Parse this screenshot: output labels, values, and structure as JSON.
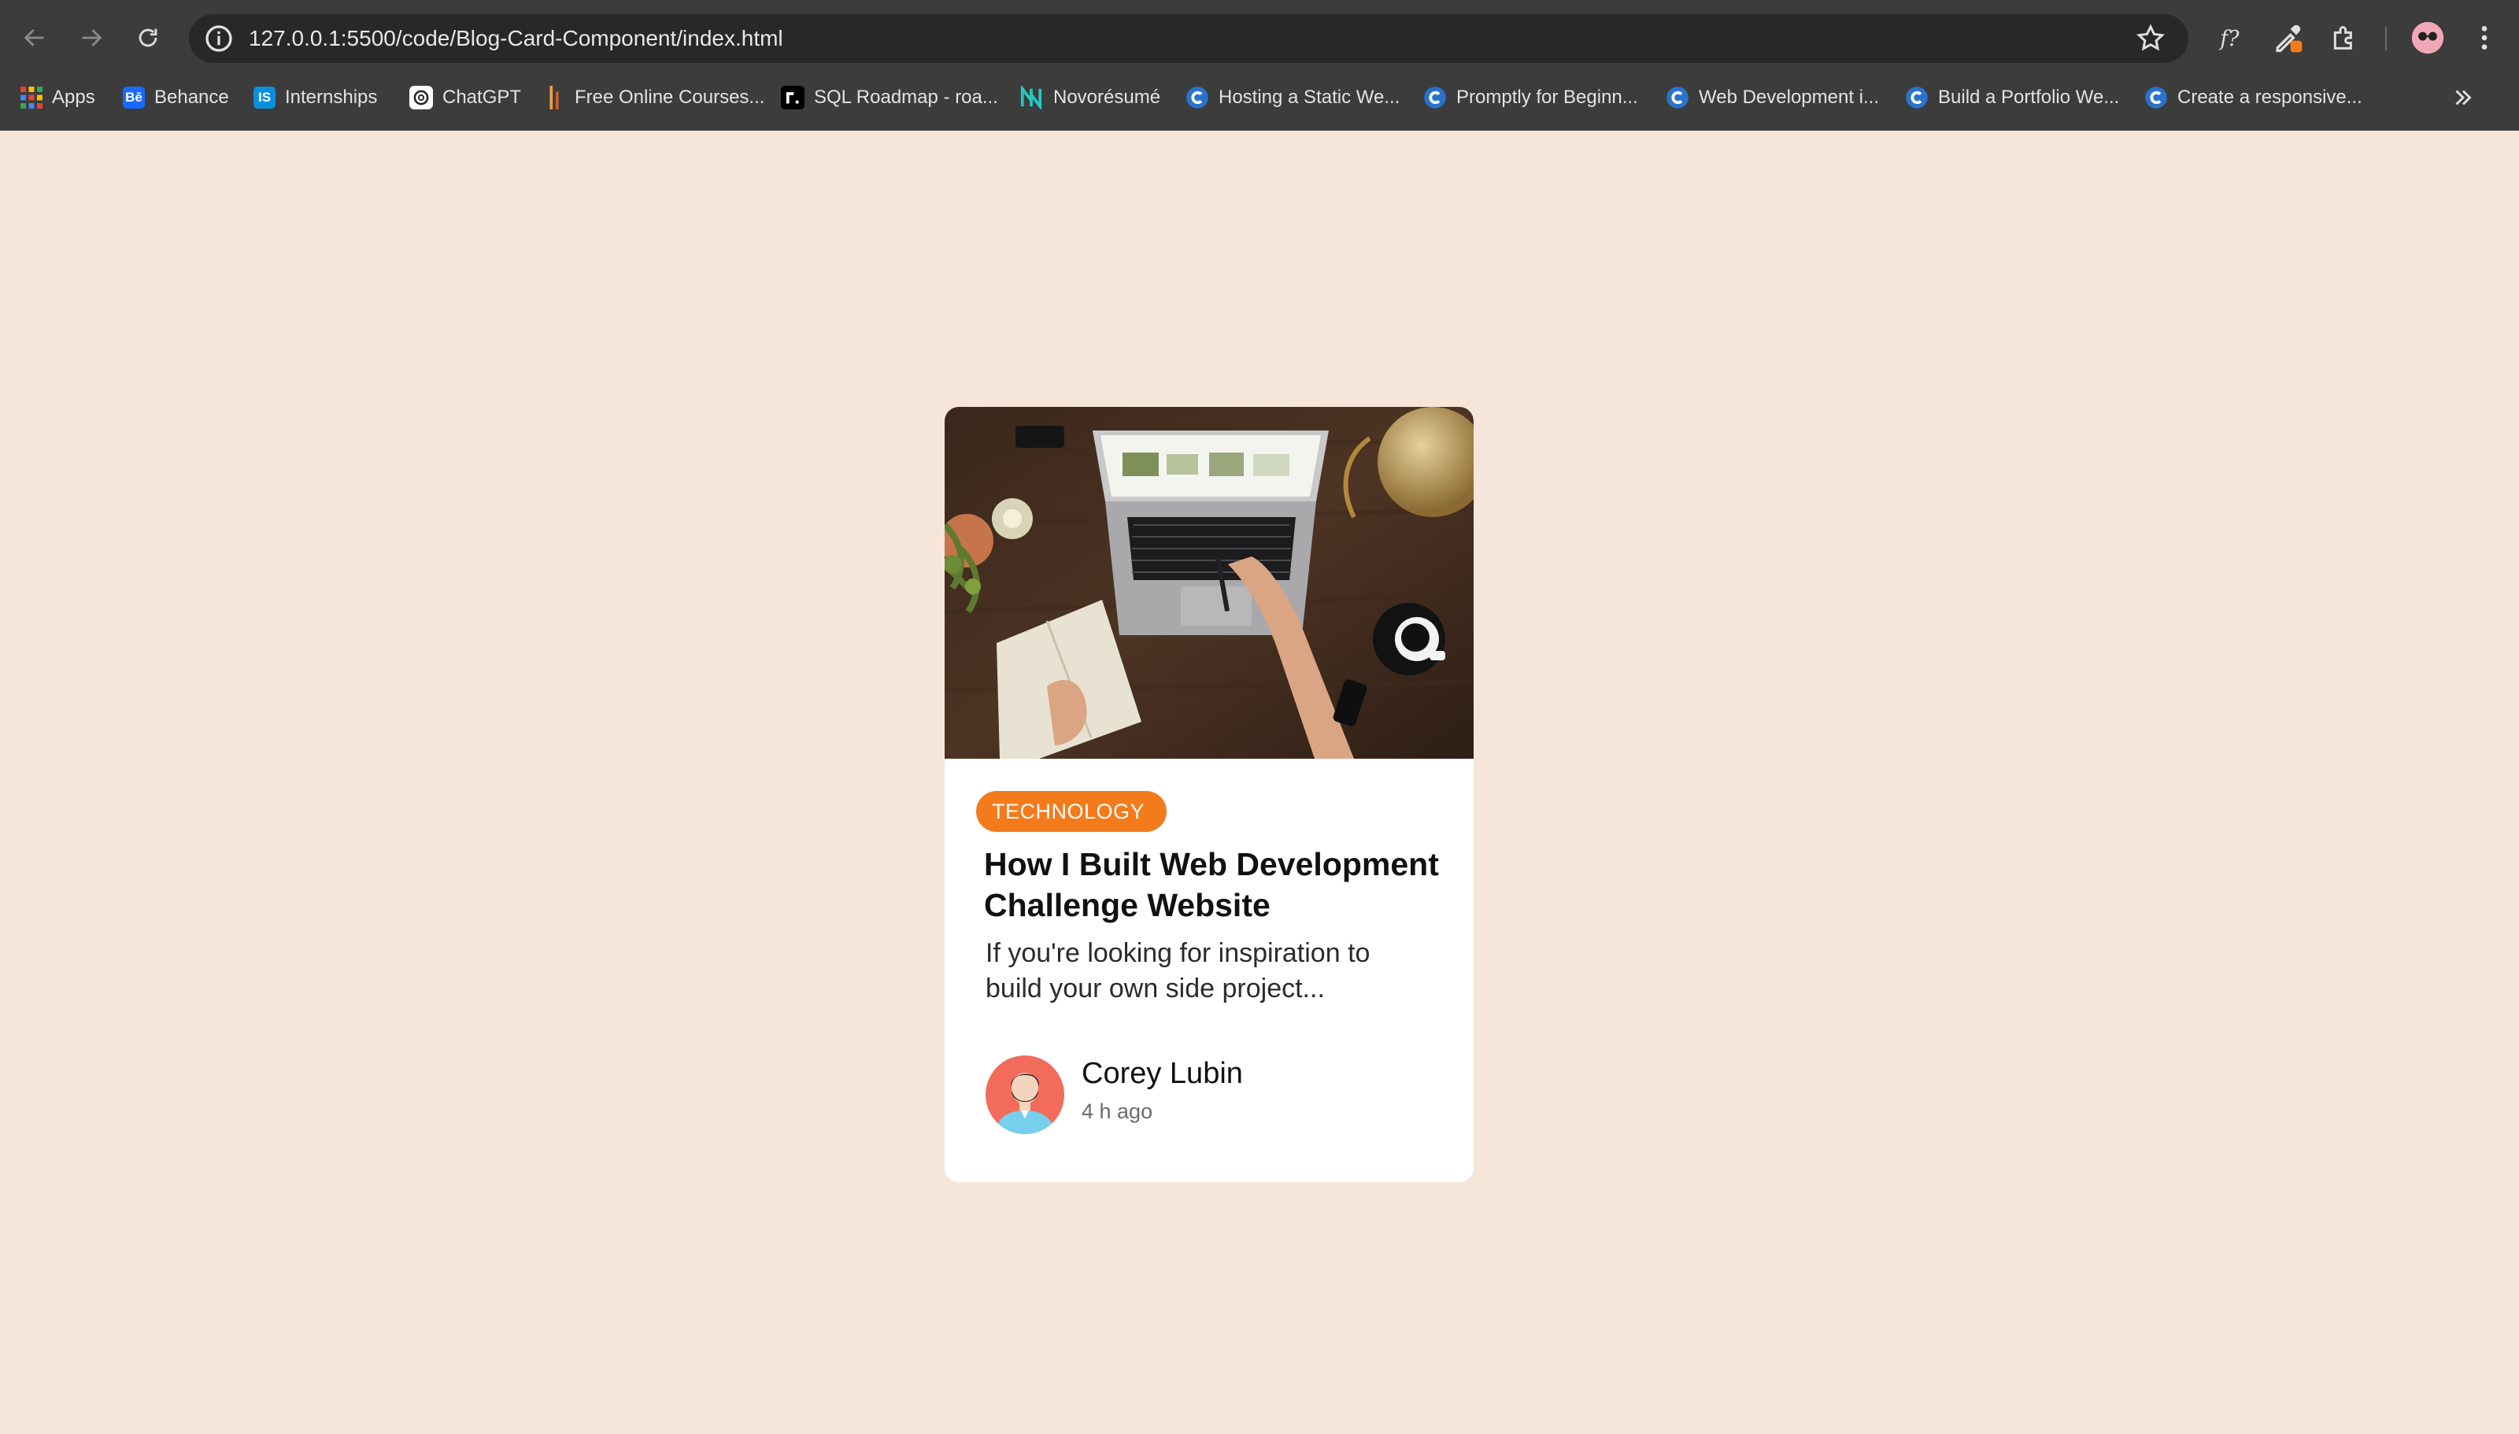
{
  "browser": {
    "url": "127.0.0.1:5500/code/Blog-Card-Component/index.html",
    "bookmarks": [
      {
        "label": "Apps",
        "icon": "apps-grid-icon"
      },
      {
        "label": "Behance",
        "icon": "behance-icon"
      },
      {
        "label": "Internships",
        "icon": "internshala-icon"
      },
      {
        "label": "ChatGPT",
        "icon": "chatgpt-icon"
      },
      {
        "label": "Free Online Courses...",
        "icon": "courses-icon"
      },
      {
        "label": "SQL Roadmap - roa...",
        "icon": "roadmap-icon"
      },
      {
        "label": "Novorésumé",
        "icon": "novoresume-icon"
      },
      {
        "label": "Hosting a Static We...",
        "icon": "coursera-icon"
      },
      {
        "label": "Promptly for Beginn...",
        "icon": "coursera-icon"
      },
      {
        "label": "Web Development i...",
        "icon": "coursera-icon"
      },
      {
        "label": "Build a Portfolio We...",
        "icon": "coursera-icon"
      },
      {
        "label": "Create a responsive...",
        "icon": "coursera-icon"
      }
    ],
    "behance_glyph": "Bē",
    "internshala_glyph": "IS"
  },
  "card": {
    "tag": "TECHNOLOGY",
    "title": "How I Built Web Development Challenge Website",
    "excerpt": "If you're looking for inspiration to build your own side project...",
    "author": {
      "name": "Corey Lubin",
      "time": "4 h ago"
    },
    "colors": {
      "page_bg": "#f5e6d9",
      "tag_bg": "#f47b1b",
      "avatar_bg": "#f26b5b"
    }
  }
}
